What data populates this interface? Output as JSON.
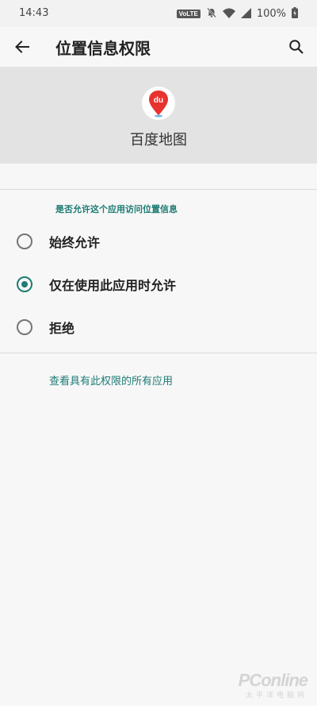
{
  "status_bar": {
    "time": "14:43",
    "volte": "VoLTE",
    "battery": "100%",
    "icons": [
      "mute-bell-icon",
      "wifi-icon",
      "signal-icon",
      "battery-charging-icon"
    ]
  },
  "app_bar": {
    "title": "位置信息权限",
    "back_icon": "arrow-back-icon",
    "search_icon": "search-icon"
  },
  "app": {
    "name": "百度地图",
    "icon": "baidu-maps-logo",
    "icon_text": "du"
  },
  "permission": {
    "question": "是否允许这个应用访问位置信息",
    "options": [
      {
        "label": "始终允许",
        "selected": false
      },
      {
        "label": "仅在使用此应用时允许",
        "selected": true
      },
      {
        "label": "拒绝",
        "selected": false
      }
    ]
  },
  "link": "查看具有此权限的所有应用",
  "watermark": {
    "main": "PConline",
    "sub": "太平洋电脑网"
  },
  "colors": {
    "accent": "#1e7b74",
    "header_bg": "#e3e3e3",
    "page_bg": "#f7f7f7"
  }
}
